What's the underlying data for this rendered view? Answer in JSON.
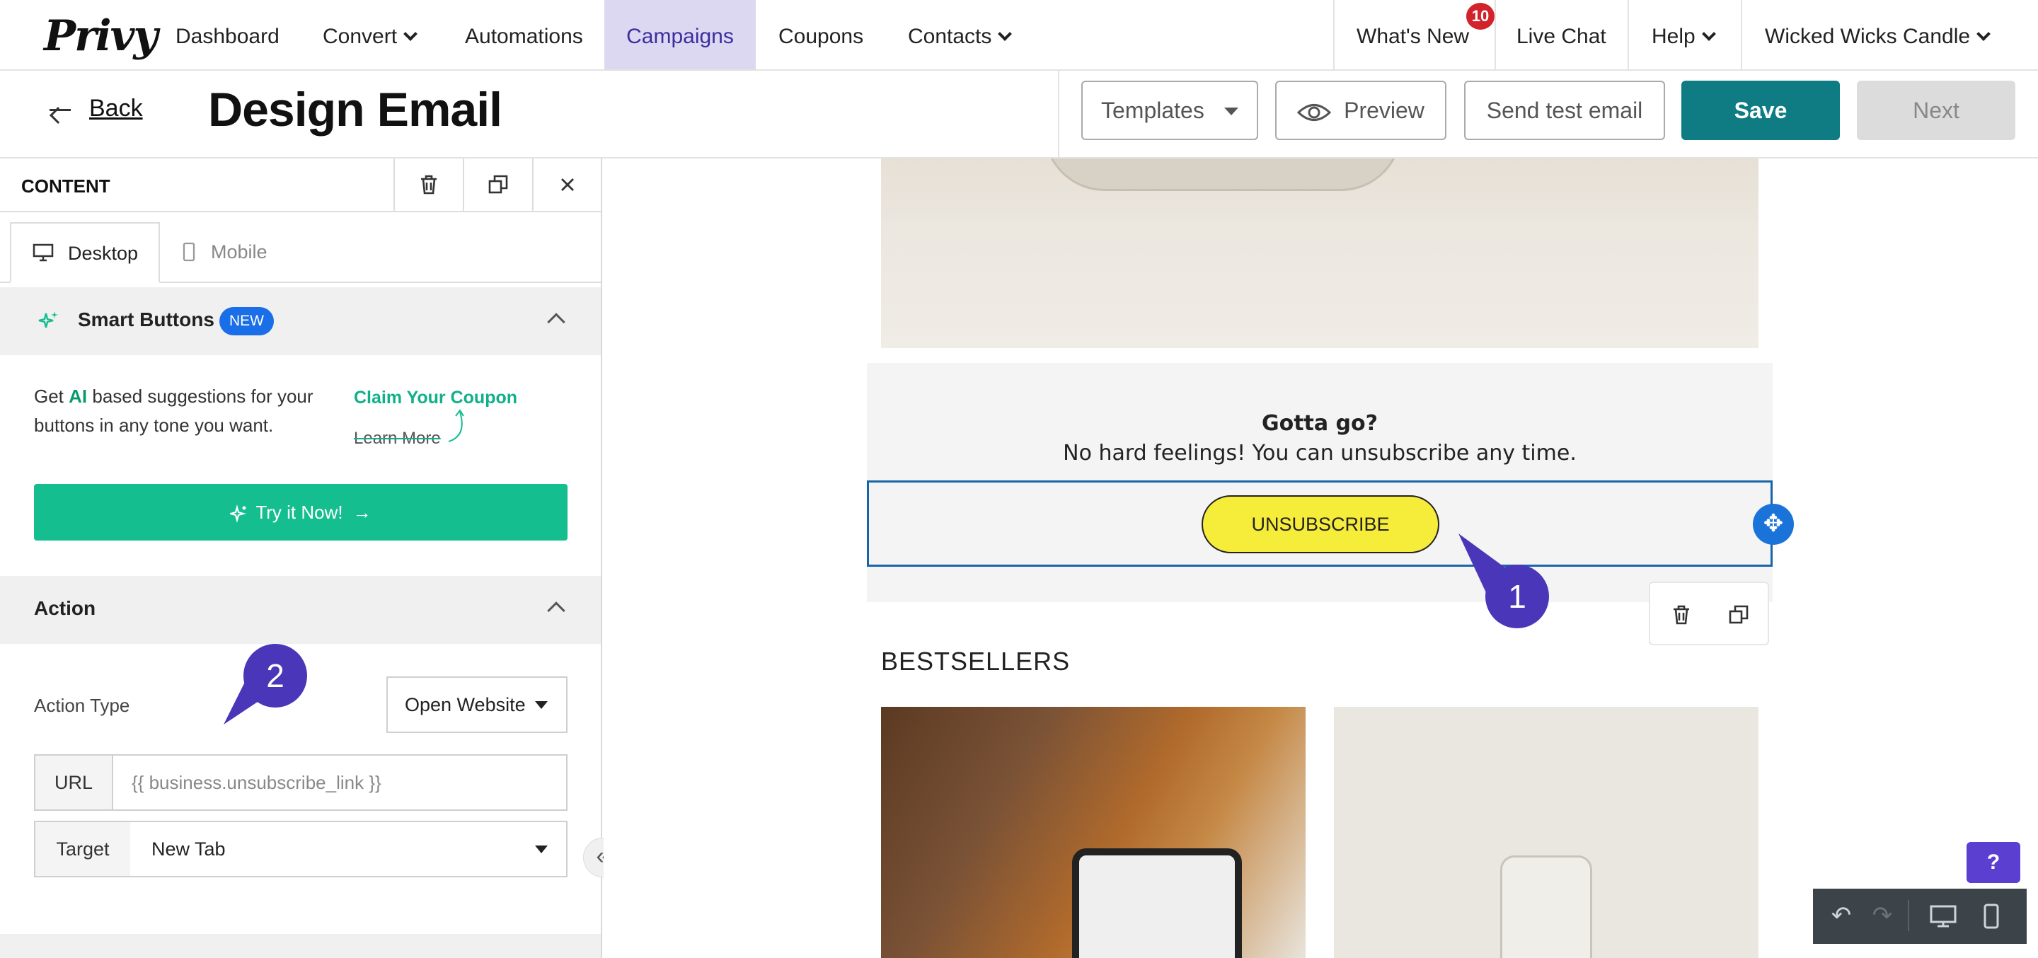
{
  "brand": {
    "logo_text": "Privy",
    "accent": "#0e7c82",
    "campaigns_highlight": "#dcd8f2"
  },
  "topnav": {
    "items": [
      {
        "label": "Dashboard"
      },
      {
        "label": "Convert"
      },
      {
        "label": "Automations"
      },
      {
        "label": "Campaigns",
        "active": true
      },
      {
        "label": "Coupons"
      },
      {
        "label": "Contacts"
      }
    ],
    "right": {
      "whats_new": "What's New",
      "whats_new_badge": "10",
      "live_chat": "Live Chat",
      "help": "Help",
      "account": "Wicked Wicks Candle"
    }
  },
  "header": {
    "back_label": "Back",
    "title": "Design Email",
    "templates_label": "Templates",
    "preview_label": "Preview",
    "send_test_label": "Send test email",
    "save_label": "Save",
    "next_label": "Next"
  },
  "panel": {
    "title": "CONTENT",
    "tabs": [
      {
        "label": "Desktop",
        "active": true
      },
      {
        "label": "Mobile"
      }
    ],
    "smart_buttons": {
      "title": "Smart Buttons",
      "badge": "NEW",
      "desc_prefix": "Get ",
      "desc_ai": "AI",
      "desc_suffix": " based suggestions for your buttons in any tone you want.",
      "example_primary": "Claim Your Coupon",
      "example_secondary": "Learn More",
      "cta": "Try it Now!"
    },
    "action": {
      "title": "Action",
      "action_type_label": "Action Type",
      "action_type_value": "Open Website",
      "url_label": "URL",
      "url_value": "{{ business.unsubscribe_link }}",
      "target_label": "Target",
      "target_value": "New Tab"
    }
  },
  "canvas": {
    "footer_title": "Gotta go?",
    "footer_subtitle": "No hard feelings! You can unsubscribe any time.",
    "unsubscribe_button": "UNSUBSCRIBE",
    "bestsellers_heading": "BESTSELLERS",
    "unsubscribe_color": "#f6ec3a"
  },
  "markers": {
    "first": "1",
    "second": "2",
    "color": "#4a36b8"
  },
  "help_fab": "?"
}
